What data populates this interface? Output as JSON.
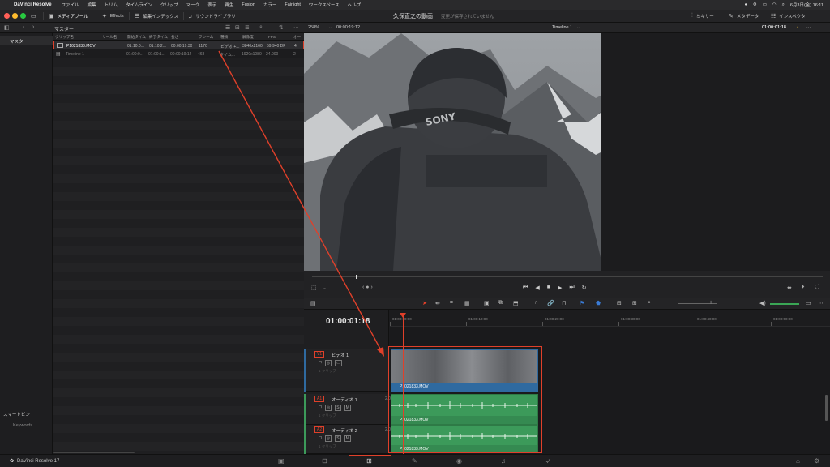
{
  "menubar": {
    "app_name": "DaVinci Resolve",
    "items": [
      "ファイル",
      "編集",
      "トリム",
      "タイムライン",
      "クリップ",
      "マーク",
      "表示",
      "再生",
      "Fusion",
      "カラー",
      "Fairlight",
      "ワークスペース",
      "ヘルプ"
    ],
    "date_time": "6月3日(金) 16:11"
  },
  "toolbar": {
    "media_pool": "メディアプール",
    "effects": "Effects",
    "edit_index": "編集インデックス",
    "sound_library": "サウンドライブラリ",
    "project_title": "久保直之の動画",
    "save_status": "変更が保存されていません",
    "mixer": "ミキサー",
    "metadata": "メタデータ",
    "inspector": "インスペクタ"
  },
  "mediapool": {
    "bin_title": "マスター",
    "sidebar_bin": "マスター",
    "smart_bins": "スマートビン",
    "keywords": "Keywords",
    "columns": [
      "クリップ名",
      "リール名",
      "開始タイム",
      "終了タイム",
      "長さ",
      "フレーム",
      "種類",
      "解像度",
      "FPS",
      "オー"
    ],
    "rows": [
      {
        "name": "P1021833.MOV",
        "reel": "",
        "start": "01:10:0...",
        "end": "01:10:2...",
        "duration": "00:00:19:30",
        "frames": "1170",
        "type": "ビデオ +...",
        "res": "3840x2160",
        "fps": "59.940 DF",
        "audio": "4"
      },
      {
        "name": "Timeline 1",
        "reel": "",
        "start": "01:00:0...",
        "end": "01:00:1...",
        "duration": "00:00:19:12",
        "frames": "468",
        "type": "タイム...",
        "res": "1920x1080",
        "fps": "24.000",
        "audio": "2"
      }
    ]
  },
  "viewer": {
    "zoom": "258%",
    "source_tc": "00:00:19:12",
    "timeline_name": "Timeline 1",
    "record_tc": "01:00:01:18"
  },
  "timeline": {
    "timecode": "01:00:01:18",
    "ruler": [
      "01:00:00:00",
      "01:00:10:00",
      "01:00:20:00",
      "01:00:30:00",
      "01:00:40:00",
      "01:00:50:00"
    ],
    "tracks": [
      {
        "tag": "V1",
        "name": "ビデオ 1",
        "num": "1",
        "sub": "1 クリップ",
        "clip": "P1021833.MOV"
      },
      {
        "tag": "A1",
        "name": "オーディオ 1",
        "num": "2.0",
        "sub": "1 クリップ",
        "clip": "P1021833.MOV"
      },
      {
        "tag": "A2",
        "name": "オーディオ 2",
        "num": "2.0",
        "sub": "1 クリップ",
        "clip": "P1021833.MOV"
      }
    ]
  },
  "pagebar": {
    "brand": "DaVinci Resolve 17"
  },
  "colors": {
    "accent_red": "#e0402a",
    "video_clip": "#2f6aa0",
    "audio_clip": "#3c9a5a"
  }
}
